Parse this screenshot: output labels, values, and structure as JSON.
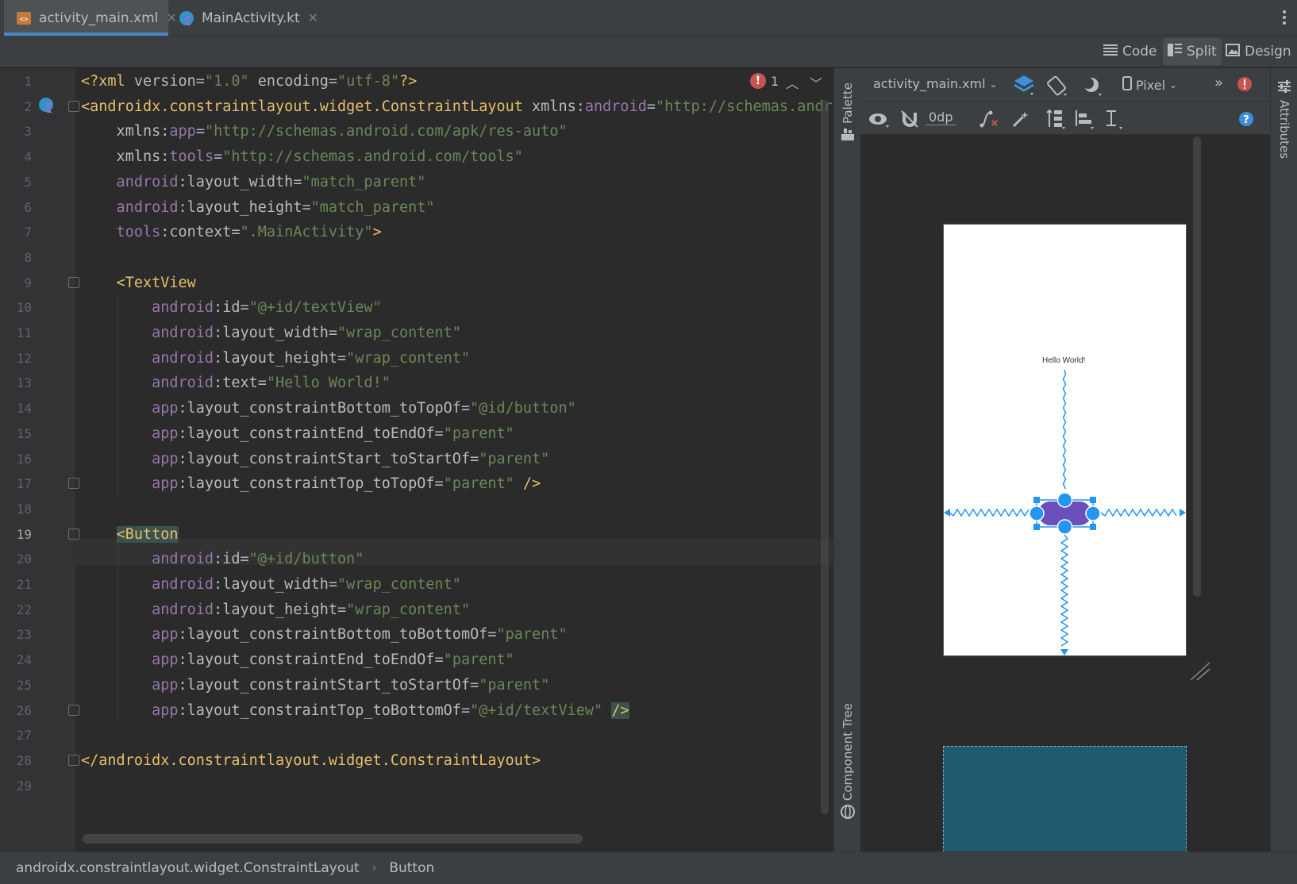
{
  "tabs": [
    {
      "label": "activity_main.xml",
      "icon": "xml-layout-icon",
      "active": true
    },
    {
      "label": "MainActivity.kt",
      "icon": "kotlin-file-icon",
      "active": false
    }
  ],
  "view_modes": {
    "code": "Code",
    "split": "Split",
    "design": "Design",
    "active": "Split"
  },
  "editor": {
    "error_count": "1",
    "current_line": 19,
    "line_numbers": [
      "1",
      "2",
      "3",
      "4",
      "5",
      "6",
      "7",
      "8",
      "9",
      "10",
      "11",
      "12",
      "13",
      "14",
      "15",
      "16",
      "17",
      "18",
      "19",
      "20",
      "21",
      "22",
      "23",
      "24",
      "25",
      "26",
      "27",
      "28",
      "29"
    ],
    "lines": [
      [
        {
          "c": "t",
          "s": "<?xml "
        },
        {
          "c": "at",
          "s": "version"
        },
        {
          "c": "eq",
          "s": "="
        },
        {
          "c": "v",
          "s": "\"1.0\""
        },
        {
          "c": "at",
          "s": " encoding"
        },
        {
          "c": "eq",
          "s": "="
        },
        {
          "c": "v",
          "s": "\"utf-8\""
        },
        {
          "c": "t",
          "s": "?>"
        }
      ],
      [
        {
          "c": "t",
          "s": "<androidx.constraintlayout.widget.ConstraintLayout "
        },
        {
          "c": "at",
          "s": "xmlns:"
        },
        {
          "c": "ns",
          "s": "android"
        },
        {
          "c": "eq",
          "s": "="
        },
        {
          "c": "v",
          "s": "\"http://schemas.android.com/apk/res/android\""
        }
      ],
      [
        {
          "c": "at",
          "s": "    xmlns:"
        },
        {
          "c": "ns",
          "s": "app"
        },
        {
          "c": "eq",
          "s": "="
        },
        {
          "c": "v",
          "s": "\"http://schemas.android.com/apk/res-auto\""
        }
      ],
      [
        {
          "c": "at",
          "s": "    xmlns:"
        },
        {
          "c": "ns",
          "s": "tools"
        },
        {
          "c": "eq",
          "s": "="
        },
        {
          "c": "v",
          "s": "\"http://schemas.android.com/tools\""
        }
      ],
      [
        {
          "c": "ns",
          "s": "    android"
        },
        {
          "c": "at",
          "s": ":layout_width"
        },
        {
          "c": "eq",
          "s": "="
        },
        {
          "c": "v",
          "s": "\"match_parent\""
        }
      ],
      [
        {
          "c": "ns",
          "s": "    android"
        },
        {
          "c": "at",
          "s": ":layout_height"
        },
        {
          "c": "eq",
          "s": "="
        },
        {
          "c": "v",
          "s": "\"match_parent\""
        }
      ],
      [
        {
          "c": "ns",
          "s": "    tools"
        },
        {
          "c": "at",
          "s": ":context"
        },
        {
          "c": "eq",
          "s": "="
        },
        {
          "c": "v",
          "s": "\".MainActivity\""
        },
        {
          "c": "t",
          "s": ">"
        }
      ],
      [],
      [
        {
          "c": "t",
          "s": "    <TextView"
        }
      ],
      [
        {
          "c": "ns",
          "s": "        android"
        },
        {
          "c": "at",
          "s": ":id"
        },
        {
          "c": "eq",
          "s": "="
        },
        {
          "c": "v",
          "s": "\"@+id/textView\""
        }
      ],
      [
        {
          "c": "ns",
          "s": "        android"
        },
        {
          "c": "at",
          "s": ":layout_width"
        },
        {
          "c": "eq",
          "s": "="
        },
        {
          "c": "v",
          "s": "\"wrap_content\""
        }
      ],
      [
        {
          "c": "ns",
          "s": "        android"
        },
        {
          "c": "at",
          "s": ":layout_height"
        },
        {
          "c": "eq",
          "s": "="
        },
        {
          "c": "v",
          "s": "\"wrap_content\""
        }
      ],
      [
        {
          "c": "ns",
          "s": "        android"
        },
        {
          "c": "at",
          "s": ":text"
        },
        {
          "c": "eq",
          "s": "="
        },
        {
          "c": "v",
          "s": "\"Hello World!\""
        }
      ],
      [
        {
          "c": "ns",
          "s": "        app"
        },
        {
          "c": "at",
          "s": ":layout_constraintBottom_toTopOf"
        },
        {
          "c": "eq",
          "s": "="
        },
        {
          "c": "v",
          "s": "\"@id/button\""
        }
      ],
      [
        {
          "c": "ns",
          "s": "        app"
        },
        {
          "c": "at",
          "s": ":layout_constraintEnd_toEndOf"
        },
        {
          "c": "eq",
          "s": "="
        },
        {
          "c": "v",
          "s": "\"parent\""
        }
      ],
      [
        {
          "c": "ns",
          "s": "        app"
        },
        {
          "c": "at",
          "s": ":layout_constraintStart_toStartOf"
        },
        {
          "c": "eq",
          "s": "="
        },
        {
          "c": "v",
          "s": "\"parent\""
        }
      ],
      [
        {
          "c": "ns",
          "s": "        app"
        },
        {
          "c": "at",
          "s": ":layout_constraintTop_toTopOf"
        },
        {
          "c": "eq",
          "s": "="
        },
        {
          "c": "v",
          "s": "\"parent\""
        },
        {
          "c": "t",
          "s": " />"
        }
      ],
      [],
      [
        {
          "c": "t",
          "s": "    "
        },
        {
          "c": "t hl",
          "s": "<Button"
        }
      ],
      [
        {
          "c": "ns",
          "s": "        android"
        },
        {
          "c": "at",
          "s": ":id"
        },
        {
          "c": "eq",
          "s": "="
        },
        {
          "c": "v",
          "s": "\"@+id/button\""
        }
      ],
      [
        {
          "c": "ns",
          "s": "        android"
        },
        {
          "c": "at",
          "s": ":layout_width"
        },
        {
          "c": "eq",
          "s": "="
        },
        {
          "c": "v",
          "s": "\"wrap_content\""
        }
      ],
      [
        {
          "c": "ns",
          "s": "        android"
        },
        {
          "c": "at",
          "s": ":layout_height"
        },
        {
          "c": "eq",
          "s": "="
        },
        {
          "c": "v",
          "s": "\"wrap_content\""
        }
      ],
      [
        {
          "c": "ns",
          "s": "        app"
        },
        {
          "c": "at",
          "s": ":layout_constraintBottom_toBottomOf"
        },
        {
          "c": "eq",
          "s": "="
        },
        {
          "c": "v",
          "s": "\"parent\""
        }
      ],
      [
        {
          "c": "ns",
          "s": "        app"
        },
        {
          "c": "at",
          "s": ":layout_constraintEnd_toEndOf"
        },
        {
          "c": "eq",
          "s": "="
        },
        {
          "c": "v",
          "s": "\"parent\""
        }
      ],
      [
        {
          "c": "ns",
          "s": "        app"
        },
        {
          "c": "at",
          "s": ":layout_constraintStart_toStartOf"
        },
        {
          "c": "eq",
          "s": "="
        },
        {
          "c": "v",
          "s": "\"parent\""
        }
      ],
      [
        {
          "c": "ns",
          "s": "        app"
        },
        {
          "c": "at",
          "s": ":layout_constraintTop_toBottomOf"
        },
        {
          "c": "eq",
          "s": "="
        },
        {
          "c": "v",
          "s": "\"@+id/textView\""
        },
        {
          "c": "t",
          "s": " "
        },
        {
          "c": "t hl",
          "s": "/>"
        }
      ],
      [],
      [
        {
          "c": "t",
          "s": "</androidx.constraintlayout.widget.ConstraintLayout>"
        }
      ],
      []
    ]
  },
  "side_panels": {
    "palette": "Palette",
    "component_tree": "Component Tree",
    "attributes": "Attributes"
  },
  "design_toolbar": {
    "file_dropdown": "activity_main.xml",
    "device_dropdown": "Pixel",
    "margin_value": "0dp"
  },
  "preview": {
    "textview_text": "Hello World!"
  },
  "breadcrumb": [
    "androidx.constraintlayout.widget.ConstraintLayout",
    "Button"
  ],
  "colors": {
    "accent": "#4a88c7",
    "error": "#c75450",
    "selection": "#2196f3",
    "button_fill": "#6b4fbb"
  }
}
